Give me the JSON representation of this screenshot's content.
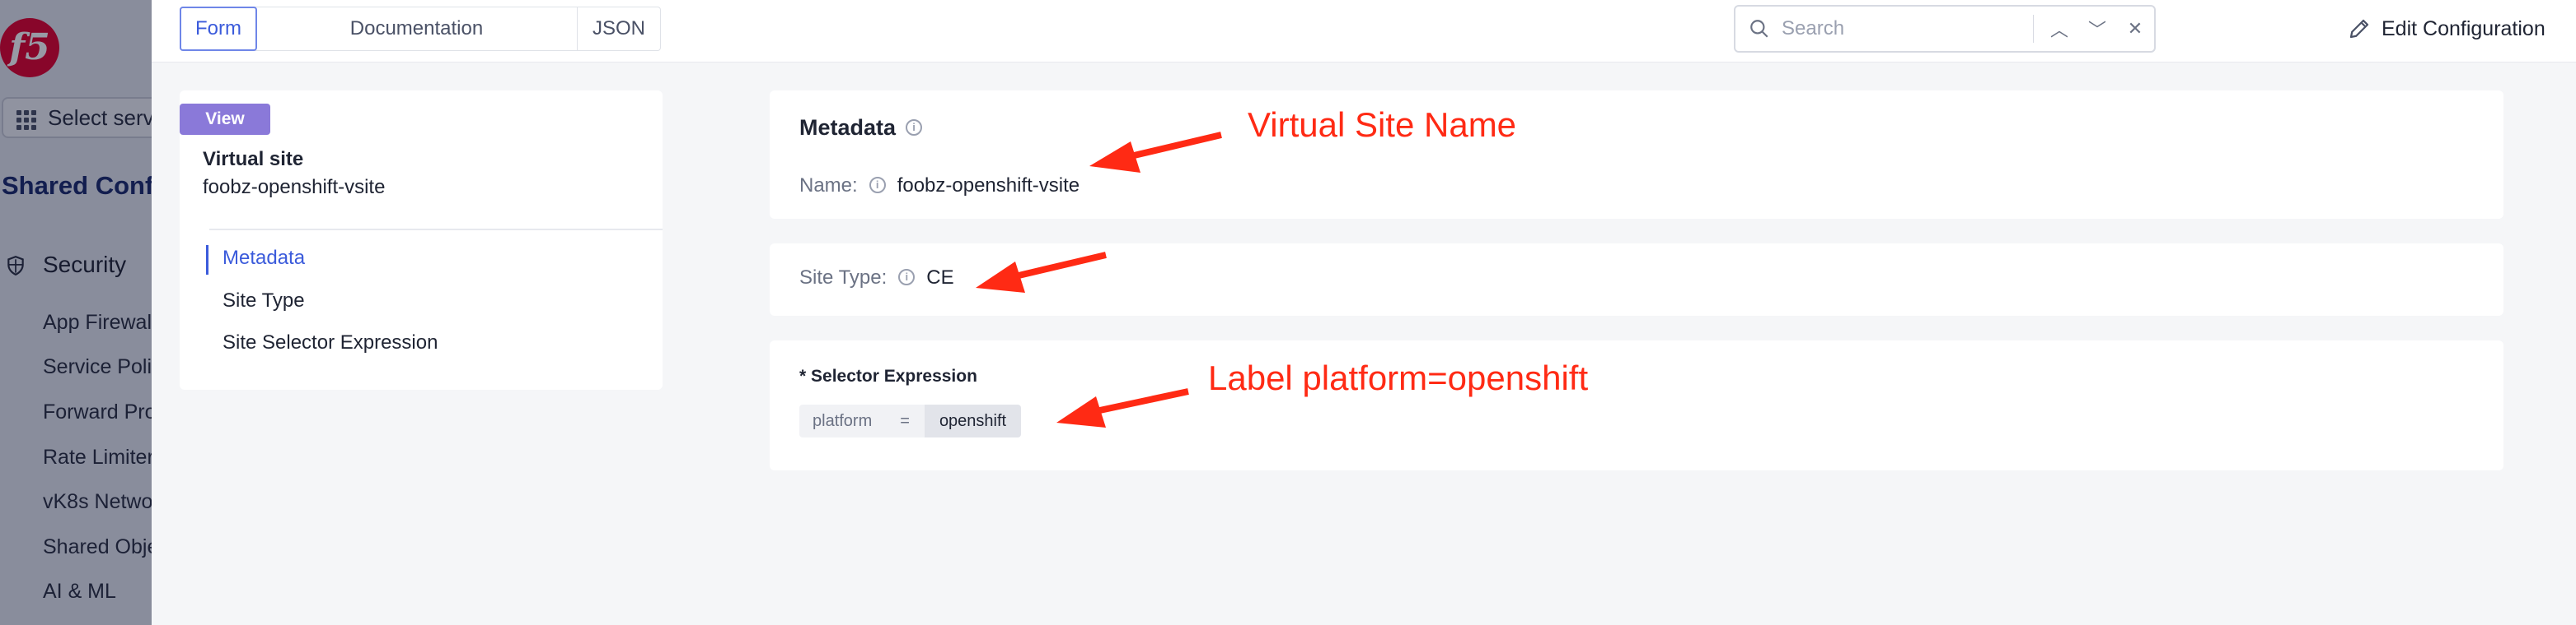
{
  "app": {
    "logo_text": "f5"
  },
  "leftnav": {
    "select_service": "Select serv",
    "title": "Shared Conf",
    "section": "Security",
    "items": [
      "App Firewal",
      "Service Poli",
      "Forward Pro",
      "Rate Limiter",
      "vK8s Netwo",
      "Shared Obje",
      "AI & ML"
    ]
  },
  "topbar": {
    "tabs": [
      {
        "label": "Form",
        "active": true
      },
      {
        "label": "Documentation",
        "active": false
      },
      {
        "label": "JSON",
        "active": false
      }
    ],
    "search_placeholder": "Search",
    "edit_label": "Edit Configuration"
  },
  "outline": {
    "badge": "View",
    "object_type": "Virtual site",
    "object_name": "foobz-openshift-vsite",
    "items": [
      {
        "label": "Metadata",
        "active": true
      },
      {
        "label": "Site Type",
        "active": false
      },
      {
        "label": "Site Selector Expression",
        "active": false
      }
    ]
  },
  "metadata": {
    "title": "Metadata",
    "name_label": "Name:",
    "name_value": "foobz-openshift-vsite"
  },
  "site_type": {
    "label": "Site Type:",
    "value": "CE"
  },
  "selector": {
    "title": "* Selector Expression",
    "key": "platform",
    "operator": "=",
    "value": "openshift"
  },
  "annotations": {
    "name": "Virtual Site Name",
    "label": "Label platform=openshift",
    "color": "#ff2a14"
  },
  "colors": {
    "accent": "#3b5bdb",
    "badge": "#8a79d9",
    "brand": "#e4002b"
  }
}
